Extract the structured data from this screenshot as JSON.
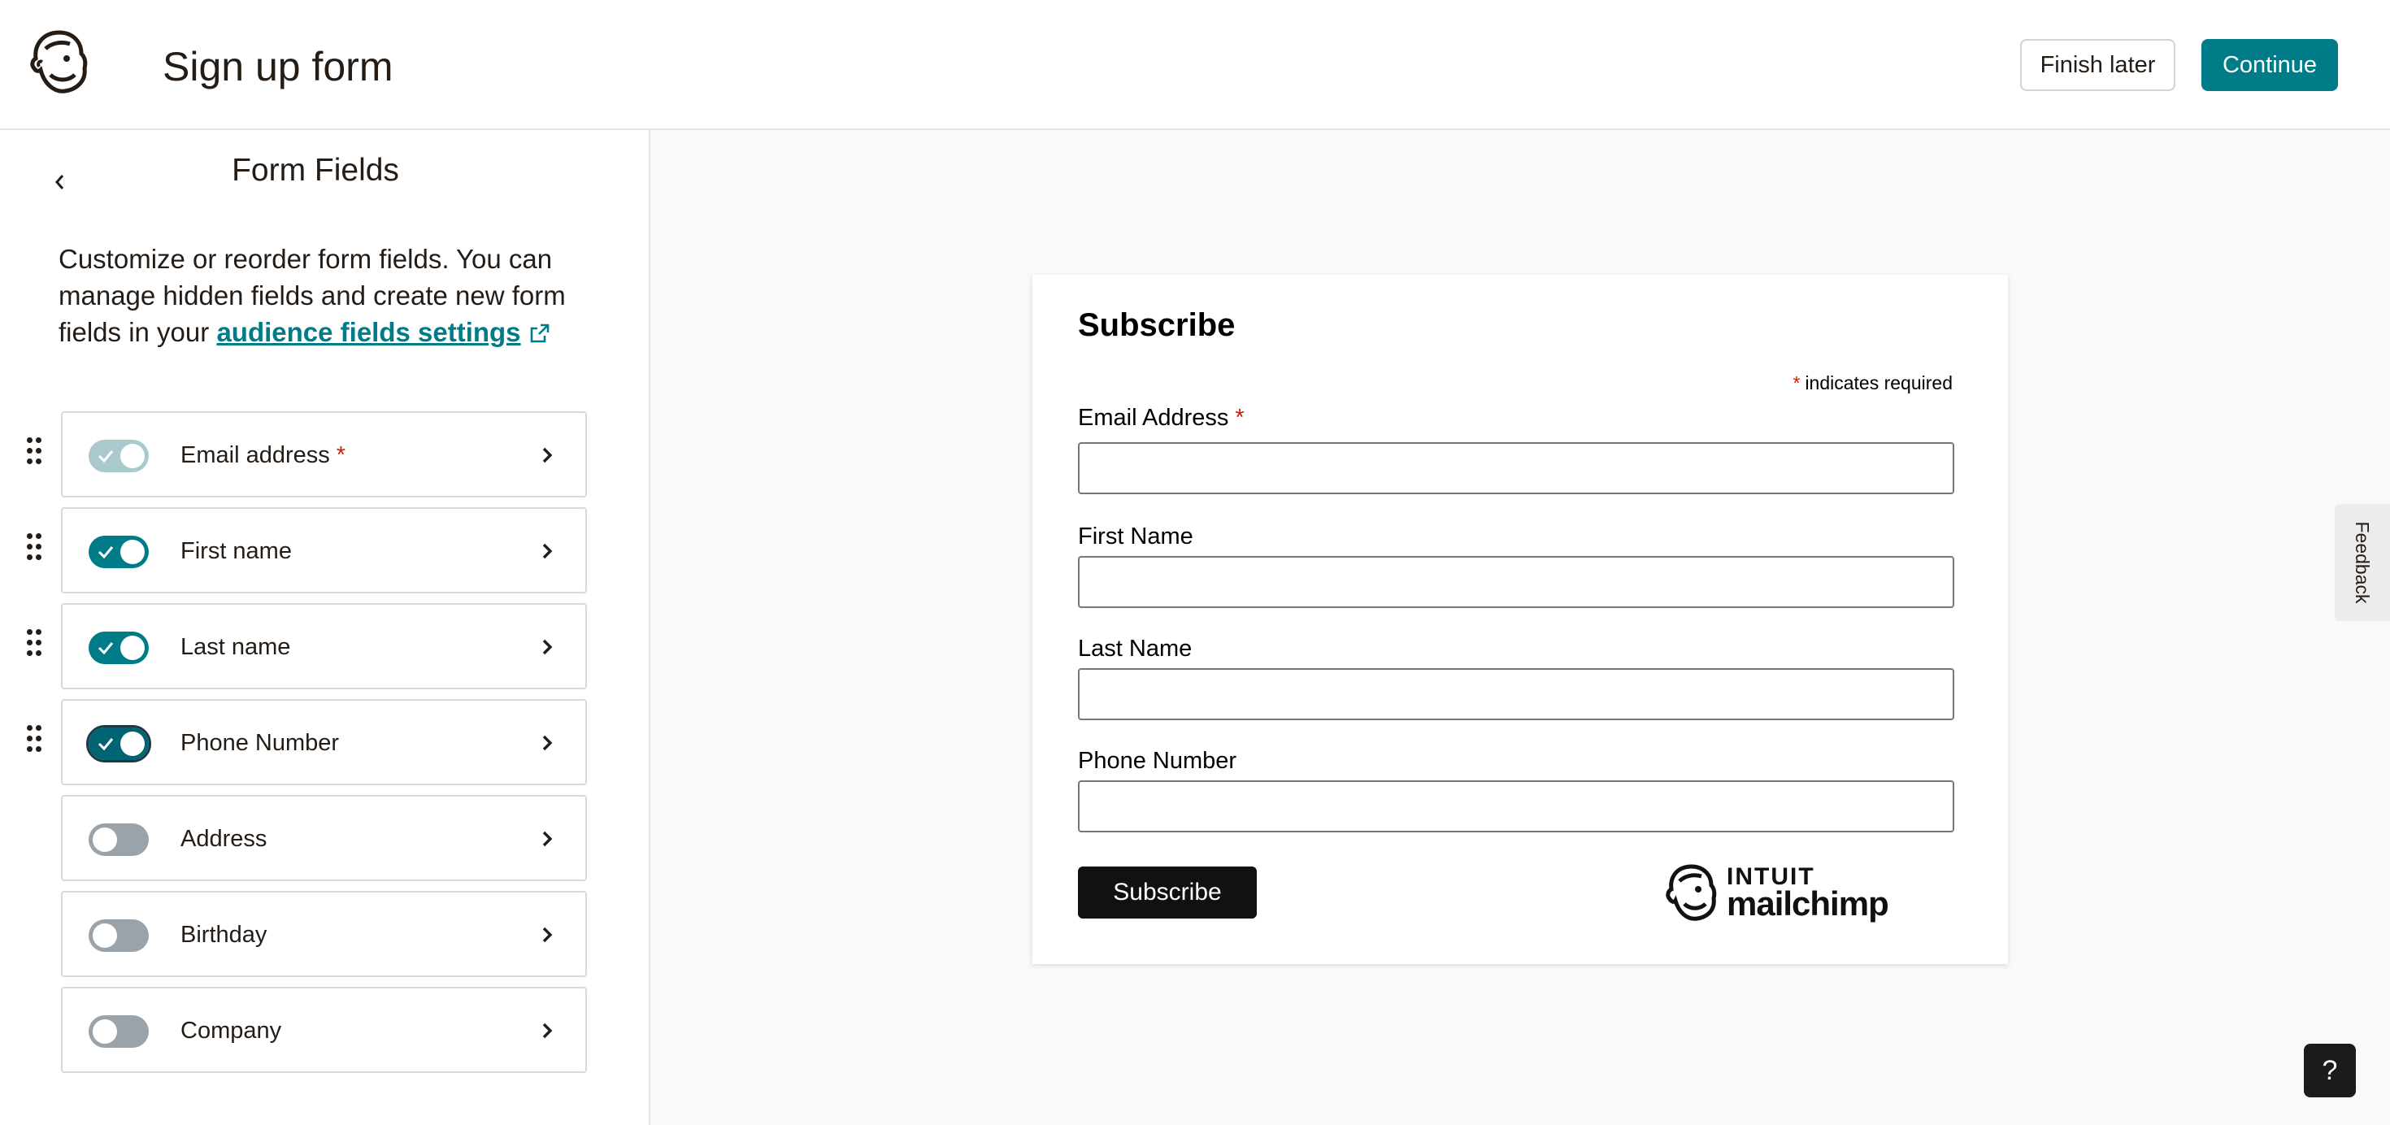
{
  "header": {
    "title": "Sign up form",
    "finish_later_label": "Finish later",
    "continue_label": "Continue",
    "logo_icon": "mailchimp-freddie-icon"
  },
  "sidebar": {
    "back_icon": "chevron-left-icon",
    "title": "Form Fields",
    "description_prefix": "Customize or reorder form fields. You can manage hidden fields and create new form fields in your ",
    "link_text": "audience fields settings",
    "link_icon": "external-link-icon",
    "fields": [
      {
        "label": "Email address",
        "required": true,
        "required_mark": "*",
        "state": "on-disabled"
      },
      {
        "label": "First name",
        "state": "on"
      },
      {
        "label": "Last name",
        "state": "on"
      },
      {
        "label": "Phone Number",
        "state": "on-focused"
      },
      {
        "label": "Address",
        "state": "off"
      },
      {
        "label": "Birthday",
        "state": "off"
      },
      {
        "label": "Company",
        "state": "off"
      }
    ]
  },
  "preview": {
    "heading": "Subscribe",
    "required_star": "*",
    "required_note": "indicates required",
    "fields": [
      {
        "label": "Email Address",
        "required_mark": "*",
        "value": ""
      },
      {
        "label": "First Name",
        "value": ""
      },
      {
        "label": "Last Name",
        "value": ""
      },
      {
        "label": "Phone Number",
        "value": ""
      }
    ],
    "subscribe_label": "Subscribe",
    "brand_top": "INTUIT",
    "brand_bottom": "mailchimp"
  },
  "feedback_label": "Feedback",
  "help_label": "?",
  "colors": {
    "accent": "#007c89",
    "required": "#d01f00",
    "text": "#241c15"
  }
}
